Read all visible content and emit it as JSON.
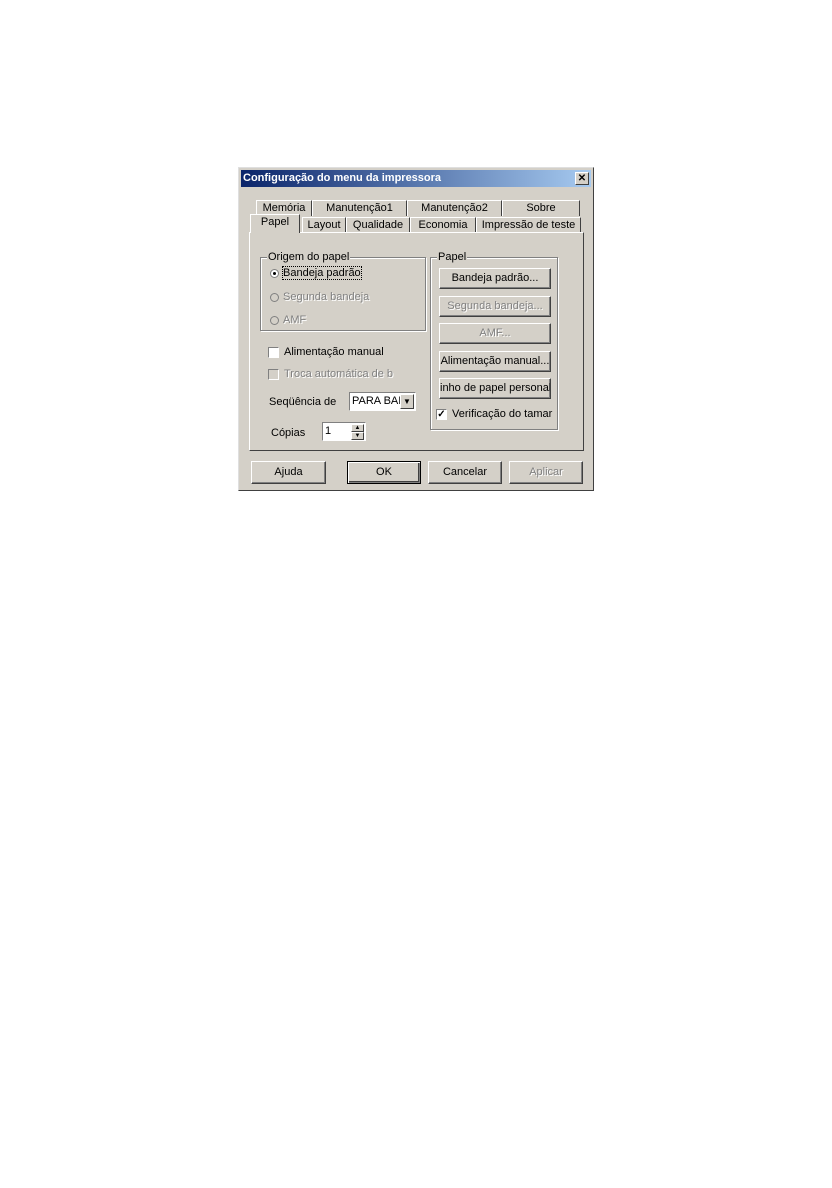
{
  "window": {
    "title": "Configuração do menu da impressora",
    "close_icon": "close-icon"
  },
  "tabs_back": [
    "Memória",
    "Manutenção1",
    "Manutenção2",
    "Sobre"
  ],
  "tabs_front": [
    "Papel",
    "Layout",
    "Qualidade",
    "Economia",
    "Impressão de teste"
  ],
  "active_tab": "Papel",
  "origem": {
    "title": "Origem do papel",
    "options": [
      "Bandeja padrão",
      "Segunda bandeja",
      "AMF"
    ],
    "selected": "Bandeja padrão"
  },
  "alimentacao_manual": {
    "label": "Alimentação manual",
    "checked": false
  },
  "troca_automatica": {
    "label": "Troca automática de b",
    "checked": false,
    "enabled": false
  },
  "sequencia": {
    "label": "Seqüência de",
    "value": "PARA BAI"
  },
  "copias": {
    "label": "Cópias",
    "value": "1"
  },
  "papel_group": {
    "title": "Papel",
    "buttons": [
      "Bandeja padrão...",
      "Segunda bandeja...",
      "AMF...",
      "Alimentação manual...",
      "inho de papel personaliz"
    ],
    "verificacao": {
      "label": "Verificação do tamar",
      "checked": true
    }
  },
  "footer": {
    "ajuda": "Ajuda",
    "ok": "OK",
    "cancelar": "Cancelar",
    "aplicar": "Aplicar"
  }
}
